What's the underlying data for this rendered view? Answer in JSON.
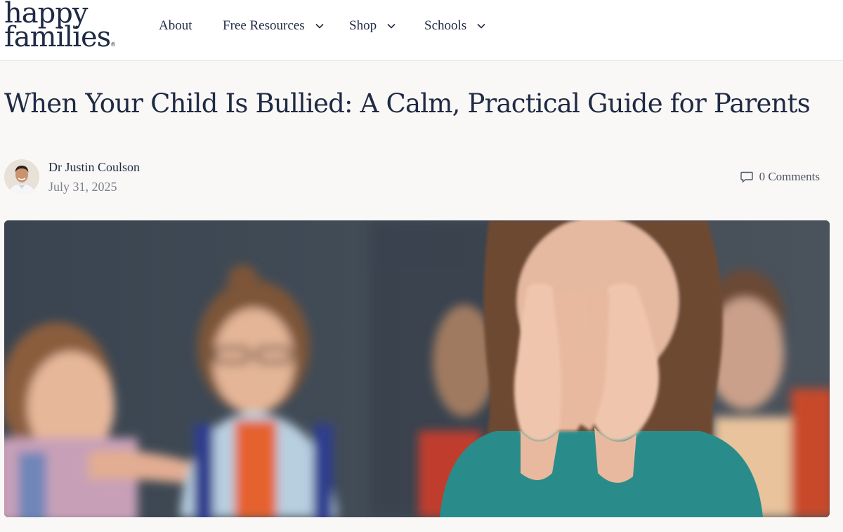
{
  "logo": {
    "line1": "happy",
    "line2": "families",
    "mark": "®"
  },
  "nav": [
    {
      "label": "About",
      "dropdown": false
    },
    {
      "label": "Free Resources",
      "dropdown": true
    },
    {
      "label": "Shop",
      "dropdown": true
    },
    {
      "label": "Schools",
      "dropdown": true
    }
  ],
  "article": {
    "title": "When Your Child Is Bullied: A Calm, Practical Guide for Parents",
    "author": "Dr Justin Coulson",
    "date": "July 31, 2025",
    "comments": "0 Comments",
    "hero_image": "photo-girl-covering-face-classmates-pointing-laughing"
  },
  "icons": {
    "chevron": "chevron-down-icon",
    "comment": "comment-bubble-icon"
  },
  "colors": {
    "text": "#1f2a44",
    "background": "#faf8f6",
    "muted": "#7b8190"
  }
}
